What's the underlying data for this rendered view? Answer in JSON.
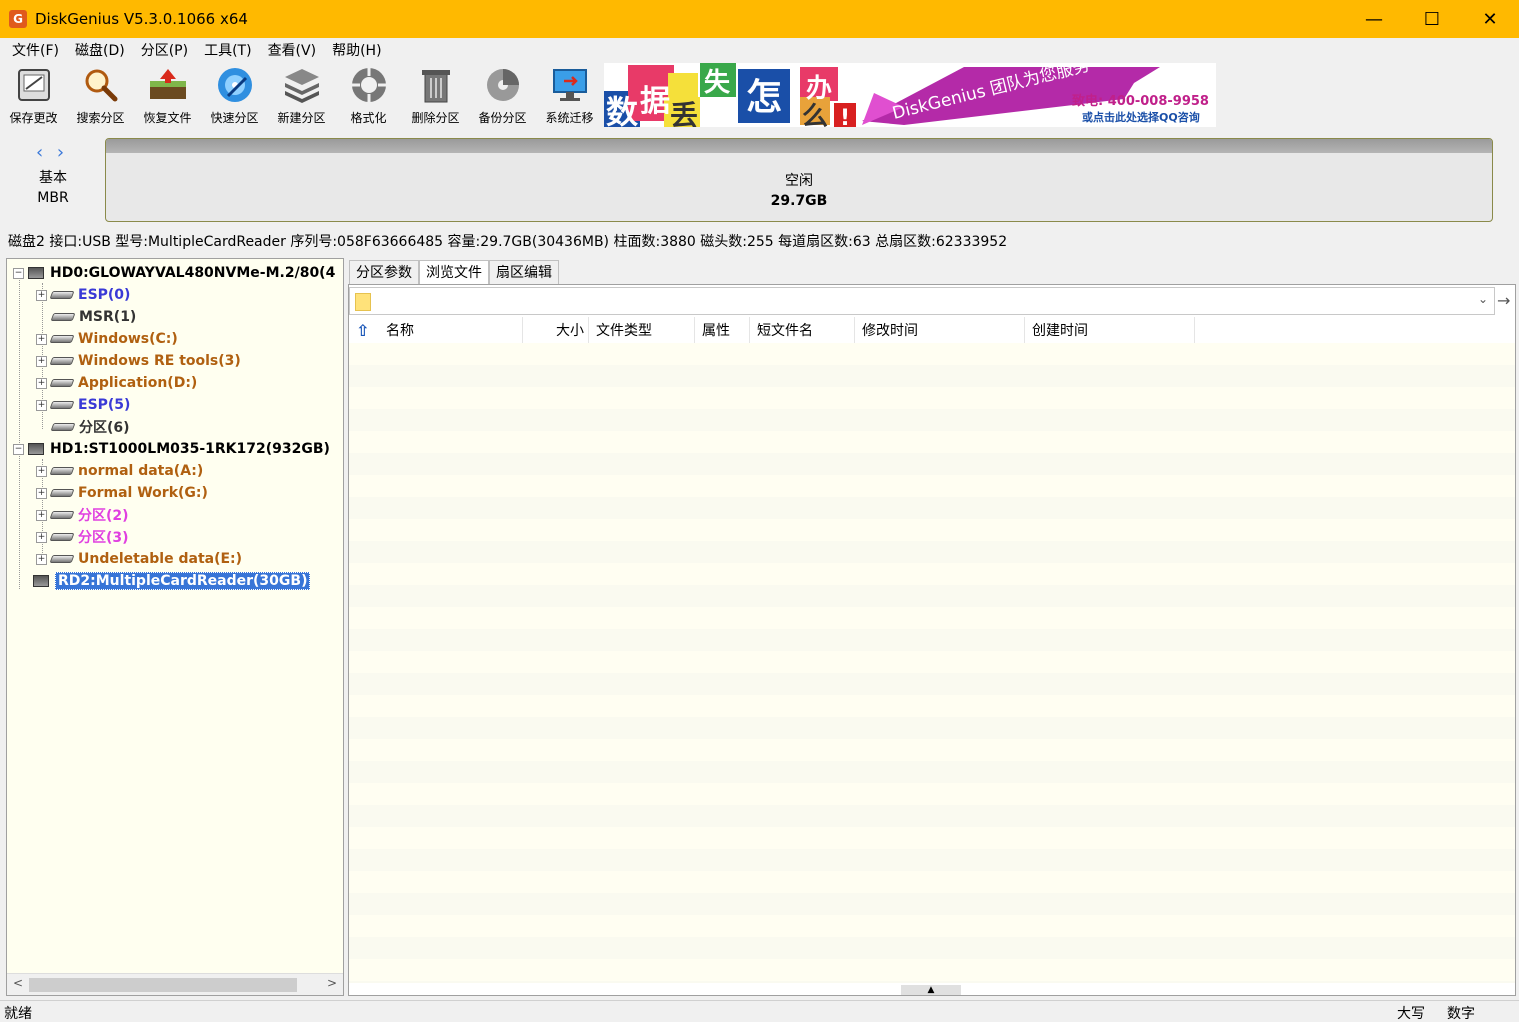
{
  "window": {
    "title": "DiskGenius V5.3.0.1066 x64",
    "icon_letter": "G",
    "minimize": "—",
    "maximize": "☐",
    "close": "✕"
  },
  "menu": [
    "文件(F)",
    "磁盘(D)",
    "分区(P)",
    "工具(T)",
    "查看(V)",
    "帮助(H)"
  ],
  "toolbar": [
    {
      "label": "保存更改",
      "icon": "save-icon"
    },
    {
      "label": "搜索分区",
      "icon": "search-icon"
    },
    {
      "label": "恢复文件",
      "icon": "recover-icon"
    },
    {
      "label": "快速分区",
      "icon": "quick-partition-icon"
    },
    {
      "label": "新建分区",
      "icon": "new-partition-icon"
    },
    {
      "label": "格式化",
      "icon": "format-icon"
    },
    {
      "label": "删除分区",
      "icon": "delete-icon"
    },
    {
      "label": "备份分区",
      "icon": "backup-icon"
    },
    {
      "label": "系统迁移",
      "icon": "migrate-icon"
    }
  ],
  "banner": {
    "chars": [
      "数",
      "据",
      "丢",
      "失",
      "怎",
      "么",
      "办"
    ],
    "exclaim": "!",
    "slogan": "DiskGenius 团队为您服务",
    "phone": "致电: 400-008-9958",
    "qq": "或点击此处选择QQ咨询"
  },
  "disk_map": {
    "disk_type": "基本",
    "table_type": "MBR",
    "free_label": "空闲",
    "free_size": "29.7GB"
  },
  "disk_info": "磁盘2 接口:USB  型号:MultipleCardReader  序列号:058F63666485  容量:29.7GB(30436MB)  柱面数:3880  磁头数:255  每道扇区数:63  总扇区数:62333952",
  "tree": {
    "disks": [
      {
        "label": "HD0:GLOWAYVAL480NVMe-M.2/80(4",
        "partitions": [
          {
            "label": "ESP(0)",
            "color": "#3a3ad6"
          },
          {
            "label": "MSR(1)",
            "color": "#333333"
          },
          {
            "label": "Windows(C:)",
            "color": "#b06010"
          },
          {
            "label": "Windows RE tools(3)",
            "color": "#b06010"
          },
          {
            "label": "Application(D:)",
            "color": "#b06010"
          },
          {
            "label": "ESP(5)",
            "color": "#3a3ad6"
          },
          {
            "label": "分区(6)",
            "color": "#333333"
          }
        ]
      },
      {
        "label": "HD1:ST1000LM035-1RK172(932GB)",
        "partitions": [
          {
            "label": "normal data(A:)",
            "color": "#b06010"
          },
          {
            "label": "Formal Work(G:)",
            "color": "#b06010"
          },
          {
            "label": "分区(2)",
            "color": "#e040e0"
          },
          {
            "label": "分区(3)",
            "color": "#e040e0"
          },
          {
            "label": "Undeletable data(E:)",
            "color": "#b06010"
          }
        ]
      },
      {
        "label": "RD2:MultipleCardReader(30GB)",
        "partitions": []
      }
    ]
  },
  "tabs": [
    "分区参数",
    "浏览文件",
    "扇区编辑"
  ],
  "active_tab": 1,
  "file_columns": [
    "名称",
    "大小",
    "文件类型",
    "属性",
    "短文件名",
    "修改时间",
    "创建时间"
  ],
  "status": {
    "left": "就绪",
    "caps": "大写",
    "num": "数字"
  }
}
